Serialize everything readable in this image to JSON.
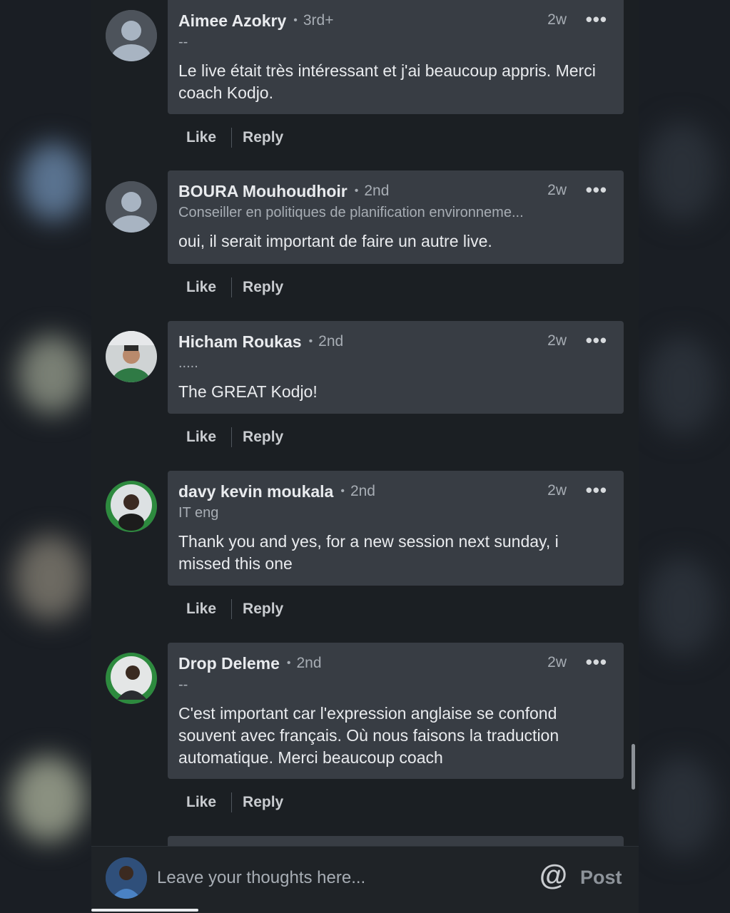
{
  "comments": [
    {
      "name": "Aimee Azokry",
      "degree": "3rd+",
      "time": "2w",
      "subtitle": "--",
      "body": "Le live était très intéressant et j'ai beaucoup appris. Merci coach Kodjo.",
      "like": "Like",
      "reply": "Reply"
    },
    {
      "name": "BOURA Mouhoudhoir",
      "degree": "2nd",
      "time": "2w",
      "subtitle": "Conseiller en politiques de planification environneme...",
      "body": "oui, il serait important de faire un autre live.",
      "like": "Like",
      "reply": "Reply"
    },
    {
      "name": "Hicham Roukas",
      "degree": "2nd",
      "time": "2w",
      "subtitle": ".....",
      "body": "The GREAT Kodjo!",
      "like": "Like",
      "reply": "Reply"
    },
    {
      "name": "davy kevin moukala",
      "degree": "2nd",
      "time": "2w",
      "subtitle": "IT eng",
      "body": "Thank you and yes, for a new session next sunday, i missed this one",
      "like": "Like",
      "reply": "Reply"
    },
    {
      "name": "Drop Deleme",
      "degree": "2nd",
      "time": "2w",
      "subtitle": "--",
      "body": "C'est important car l'expression anglaise se confond souvent avec français. Où nous faisons la traduction automatique. Merci beaucoup coach",
      "like": "Like",
      "reply": "Reply"
    }
  ],
  "composer": {
    "placeholder": "Leave your thoughts here...",
    "post_label": "Post",
    "mention_symbol": "@"
  },
  "separator": "•",
  "more_icon": "•••"
}
